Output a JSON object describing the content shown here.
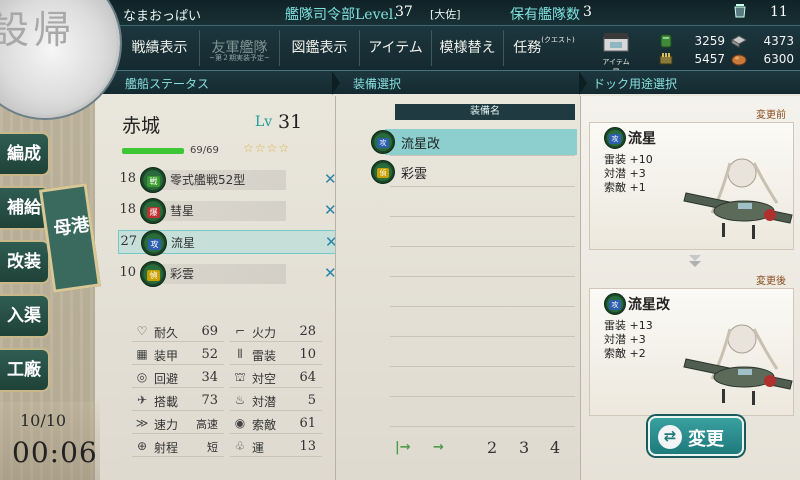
{
  "header": {
    "player_name": "なまおっぱい",
    "hq_level_label": "艦隊司令部Level.",
    "hq_level": "37",
    "rank": "[大佐]",
    "ship_count_label": "保有艦隊数",
    "ship_count": "3",
    "unit_count": "11"
  },
  "menu": {
    "record": "戦績表示",
    "friend_fleet": "友軍艦隊",
    "friend_fleet_note": "~第２期実装予定~",
    "library": "図鑑表示",
    "items": "アイテム",
    "remodel": "模様替え",
    "quests": "任務",
    "quests_sup": "(クエスト)",
    "item_shop_label": "アイテム屋"
  },
  "resources": {
    "fuel": "3259",
    "ammo": "5457",
    "steel": "4373",
    "bauxite": "6300"
  },
  "sections": {
    "ship_status": "艦船ステータス",
    "equip_select": "装備選択",
    "dock_select": "ドック用途選択"
  },
  "nav": {
    "circle_text": "設帰",
    "organize": "編成",
    "supply": "補給",
    "remodel": "改装",
    "dock": "入渠",
    "factory": "工廠",
    "port": "母港"
  },
  "clock": {
    "date": "10/10",
    "time": "00:06"
  },
  "ship": {
    "name": "赤城",
    "lv_label": "Lv",
    "level": "31",
    "hp": "69/69",
    "hp_fraction": 1.0,
    "stars": "☆☆☆☆"
  },
  "slots": [
    {
      "count": "18",
      "icon": "fighter-icon",
      "tag": "戦",
      "tag_color": "#3a9a2e",
      "name": "零式艦戦52型"
    },
    {
      "count": "18",
      "icon": "bomber-icon",
      "tag": "爆",
      "tag_color": "#c03030",
      "name": "彗星"
    },
    {
      "count": "27",
      "icon": "torpedo-bomber-icon",
      "tag": "攻",
      "tag_color": "#2d5fb0",
      "name": "流星"
    },
    {
      "count": "10",
      "icon": "recon-icon",
      "tag": "偵",
      "tag_color": "#c9a000",
      "name": "彩雲"
    }
  ],
  "stats": {
    "hp_label": "耐久",
    "hp": "69",
    "firepower_label": "火力",
    "firepower": "28",
    "armor_label": "装甲",
    "armor": "52",
    "torpedo_label": "雷装",
    "torpedo": "10",
    "evasion_label": "回避",
    "evasion": "34",
    "aa_label": "対空",
    "aa": "64",
    "aircraft_label": "搭載",
    "aircraft": "73",
    "asw_label": "対潜",
    "asw": "5",
    "speed_label": "速力",
    "speed": "高速",
    "los_label": "索敵",
    "los": "61",
    "range_label": "射程",
    "range": "短",
    "luck_label": "運",
    "luck": "13"
  },
  "equip_list": {
    "header": "装備名",
    "items": [
      {
        "name": "流星改",
        "tag": "攻",
        "tag_color": "#2d5fb0",
        "icon": "torpedo-bomber-icon"
      },
      {
        "name": "彩雲",
        "tag": "偵",
        "tag_color": "#c9a000",
        "icon": "recon-icon"
      }
    ],
    "pages": [
      "2",
      "3",
      "4"
    ]
  },
  "dock": {
    "before_label": "変更前",
    "after_label": "変更後",
    "before": {
      "name": "流星",
      "stats": [
        "雷装 +10",
        "対潜 +3",
        "索敵 +1"
      ]
    },
    "after": {
      "name": "流星改",
      "stats": [
        "雷装 +13",
        "対潜 +3",
        "索敵 +2"
      ]
    },
    "change_button": "変更"
  }
}
